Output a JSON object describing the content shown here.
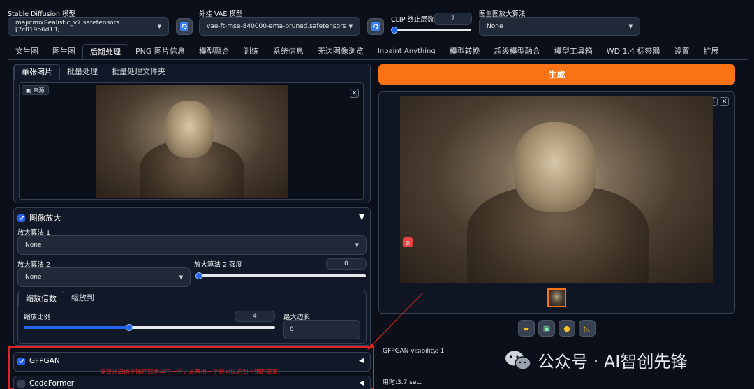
{
  "top": {
    "sd_model_label": "Stable Diffusion 模型",
    "sd_model_value": "majicmixRealistic_v7.safetensors [7c819b6d13]",
    "vae_label": "外挂 VAE 模型",
    "vae_value": "vae-ft-mse-840000-ema-pruned.safetensors",
    "clip_label": "CLIP 终止层数",
    "clip_value": "2",
    "clip_fraction": 0.0,
    "upscaler_label": "图生图放大算法",
    "upscaler_value": "None"
  },
  "main_tabs": [
    {
      "label": "文生图"
    },
    {
      "label": "图生图"
    },
    {
      "label": "后期处理",
      "active": true
    },
    {
      "label": "PNG 图片信息"
    },
    {
      "label": "模型融合"
    },
    {
      "label": "训练"
    },
    {
      "label": "系统信息"
    },
    {
      "label": "无边图像浏览"
    },
    {
      "label": "Inpaint Anything"
    },
    {
      "label": "模型转换"
    },
    {
      "label": "超级模型融合"
    },
    {
      "label": "模型工具箱"
    },
    {
      "label": "WD 1.4 标签器"
    },
    {
      "label": "设置"
    },
    {
      "label": "扩展"
    }
  ],
  "sub_tabs": [
    {
      "label": "单张图片",
      "active": true
    },
    {
      "label": "批量处理"
    },
    {
      "label": "批量处理文件夹"
    }
  ],
  "source": {
    "label": "来源",
    "close": "✕"
  },
  "upscale": {
    "section_label": "图像放大",
    "collapse": "▼",
    "algo1_label": "放大算法 1",
    "algo1_value": "None",
    "algo2_label": "放大算法 2",
    "algo2_value": "None",
    "algo2_strength_label": "放大算法 2 强度",
    "algo2_strength_value": "0",
    "inner_tabs": [
      {
        "label": "缩放倍数",
        "active": true
      },
      {
        "label": "缩放到"
      }
    ],
    "scale_label": "缩放比例",
    "scale_value": "4",
    "scale_fraction": 0.42,
    "max_edge_label": "最大边长",
    "max_edge_value": "0"
  },
  "gfpgan": {
    "label": "GFPGAN",
    "arrow": "◀"
  },
  "codeformer": {
    "label": "CodeFormer",
    "arrow": "◀"
  },
  "annotation": {
    "text": "需要开启两个插件或者其中一个，正常用一个就可以达到不错的效果",
    "color": "#e11d1d"
  },
  "output": {
    "generate_label": "生成",
    "gfpgan_info": "GFPGAN visibility: 1",
    "time_info": "用时:3.7 sec.",
    "download_icon": "⇩",
    "close": "✕"
  },
  "watermark": {
    "text": "公众号 · AI智创先锋"
  },
  "colors": {
    "accent": "#2563eb",
    "generate": "#f97316",
    "background": "#0b0f19"
  }
}
